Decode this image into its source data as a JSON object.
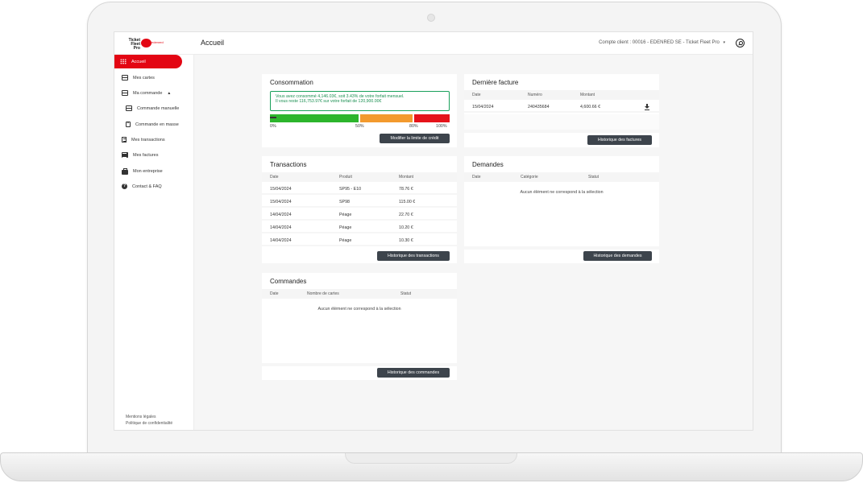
{
  "header": {
    "logo_text": "Ticket Fleet Pro",
    "logo_brand": "edenred",
    "page_title": "Accueil",
    "account_label": "Compte client :",
    "account_value": "00016 - EDENRED SE - Ticket Fleet Pro",
    "account_caret": "▾"
  },
  "sidebar": {
    "items": [
      {
        "label": "Accueil",
        "icon": "grid-icon"
      },
      {
        "label": "Mes cartes",
        "icon": "card-icon"
      },
      {
        "label": "Ma commande",
        "icon": "card-icon",
        "caret": "▲"
      },
      {
        "label": "Commande manuelle",
        "icon": "card-icon"
      },
      {
        "label": "Commande en masse",
        "icon": "document-icon"
      },
      {
        "label": "Mes transactions",
        "icon": "receipt-icon"
      },
      {
        "label": "Mes factures",
        "icon": "list-icon"
      },
      {
        "label": "Mon entreprise",
        "icon": "briefcase-icon"
      },
      {
        "label": "Contact & FAQ",
        "icon": "help-icon"
      }
    ],
    "footer": [
      "Mentions légales",
      "Politique de confidentialité"
    ]
  },
  "consommation": {
    "title": "Consommation",
    "notice_line1": "Vous avez consommé 4,146.03€, soit 3.43% de votre forfait mensuel.",
    "notice_line2": "Il vous reste 116,753.97€ sur votre forfait de 120,900.00€",
    "usage_percent": 3.43,
    "labels": [
      "0%",
      "50%",
      "80%",
      "100%"
    ],
    "button": "Modifier la limite de crédit",
    "colors": {
      "green": "#2cb52c",
      "orange": "#f39a2e",
      "red": "#e5131a"
    }
  },
  "facture": {
    "title": "Dernière facture",
    "headers": [
      "Date",
      "Numéro",
      "Montant"
    ],
    "rows": [
      {
        "date": "15/04/2024",
        "numero": "240435684",
        "montant": "4,600.66 €"
      }
    ],
    "button": "Historique des factures"
  },
  "transactions": {
    "title": "Transactions",
    "headers": [
      "Date",
      "Produit",
      "Montant"
    ],
    "rows": [
      {
        "date": "15/04/2024",
        "produit": "SP95 - E10",
        "montant": "78.76 €"
      },
      {
        "date": "15/04/2024",
        "produit": "SP98",
        "montant": "115.00 €"
      },
      {
        "date": "14/04/2024",
        "produit": "Péage",
        "montant": "22.70 €"
      },
      {
        "date": "14/04/2024",
        "produit": "Péage",
        "montant": "10.20 €"
      },
      {
        "date": "14/04/2024",
        "produit": "Péage",
        "montant": "10.30 €"
      }
    ],
    "button": "Historique des transactions"
  },
  "demandes": {
    "title": "Demandes",
    "headers": [
      "Date",
      "Catégorie",
      "Statut"
    ],
    "empty": "Aucun élément ne correspond à la sélection",
    "button": "Historique des demandes"
  },
  "commandes": {
    "title": "Commandes",
    "headers": [
      "Date",
      "Nombre de cartes",
      "Statut"
    ],
    "empty": "Aucun élément ne correspond à la sélection",
    "button": "Historique des commandes"
  }
}
